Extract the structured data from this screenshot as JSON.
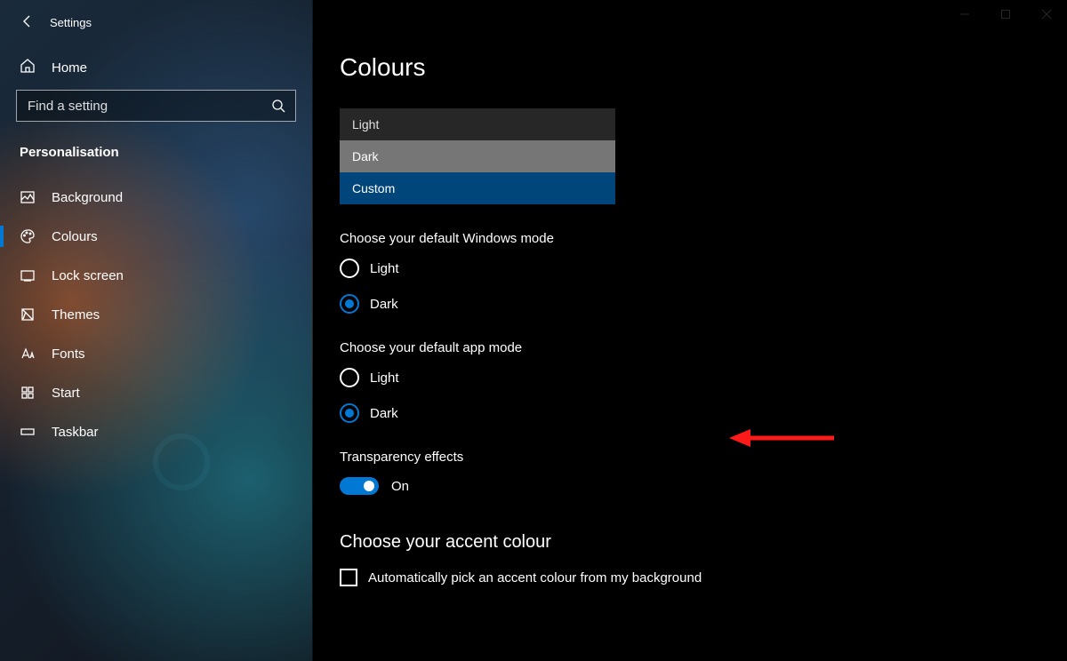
{
  "titlebar": {
    "app_name": "Settings"
  },
  "sidebar": {
    "home_label": "Home",
    "search_placeholder": "Find a setting",
    "section_label": "Personalisation",
    "items": [
      {
        "id": "background",
        "label": "Background",
        "active": false
      },
      {
        "id": "colours",
        "label": "Colours",
        "active": true
      },
      {
        "id": "lock-screen",
        "label": "Lock screen",
        "active": false
      },
      {
        "id": "themes",
        "label": "Themes",
        "active": false
      },
      {
        "id": "fonts",
        "label": "Fonts",
        "active": false
      },
      {
        "id": "start",
        "label": "Start",
        "active": false
      },
      {
        "id": "taskbar",
        "label": "Taskbar",
        "active": false
      }
    ]
  },
  "main": {
    "page_title": "Colours",
    "colour_dropdown": {
      "options": {
        "light": "Light",
        "dark": "Dark",
        "custom": "Custom"
      },
      "selected": "custom"
    },
    "windows_mode": {
      "heading": "Choose your default Windows mode",
      "light": "Light",
      "dark": "Dark",
      "value": "dark"
    },
    "app_mode": {
      "heading": "Choose your default app mode",
      "light": "Light",
      "dark": "Dark",
      "value": "dark"
    },
    "transparency": {
      "heading": "Transparency effects",
      "state_label": "On",
      "on": true
    },
    "accent": {
      "heading": "Choose your accent colour",
      "auto_checkbox_label": "Automatically pick an accent colour from my background",
      "auto_checked": false
    }
  },
  "colors": {
    "accent": "#0078d4",
    "annotation_red": "#ff1a1a"
  }
}
